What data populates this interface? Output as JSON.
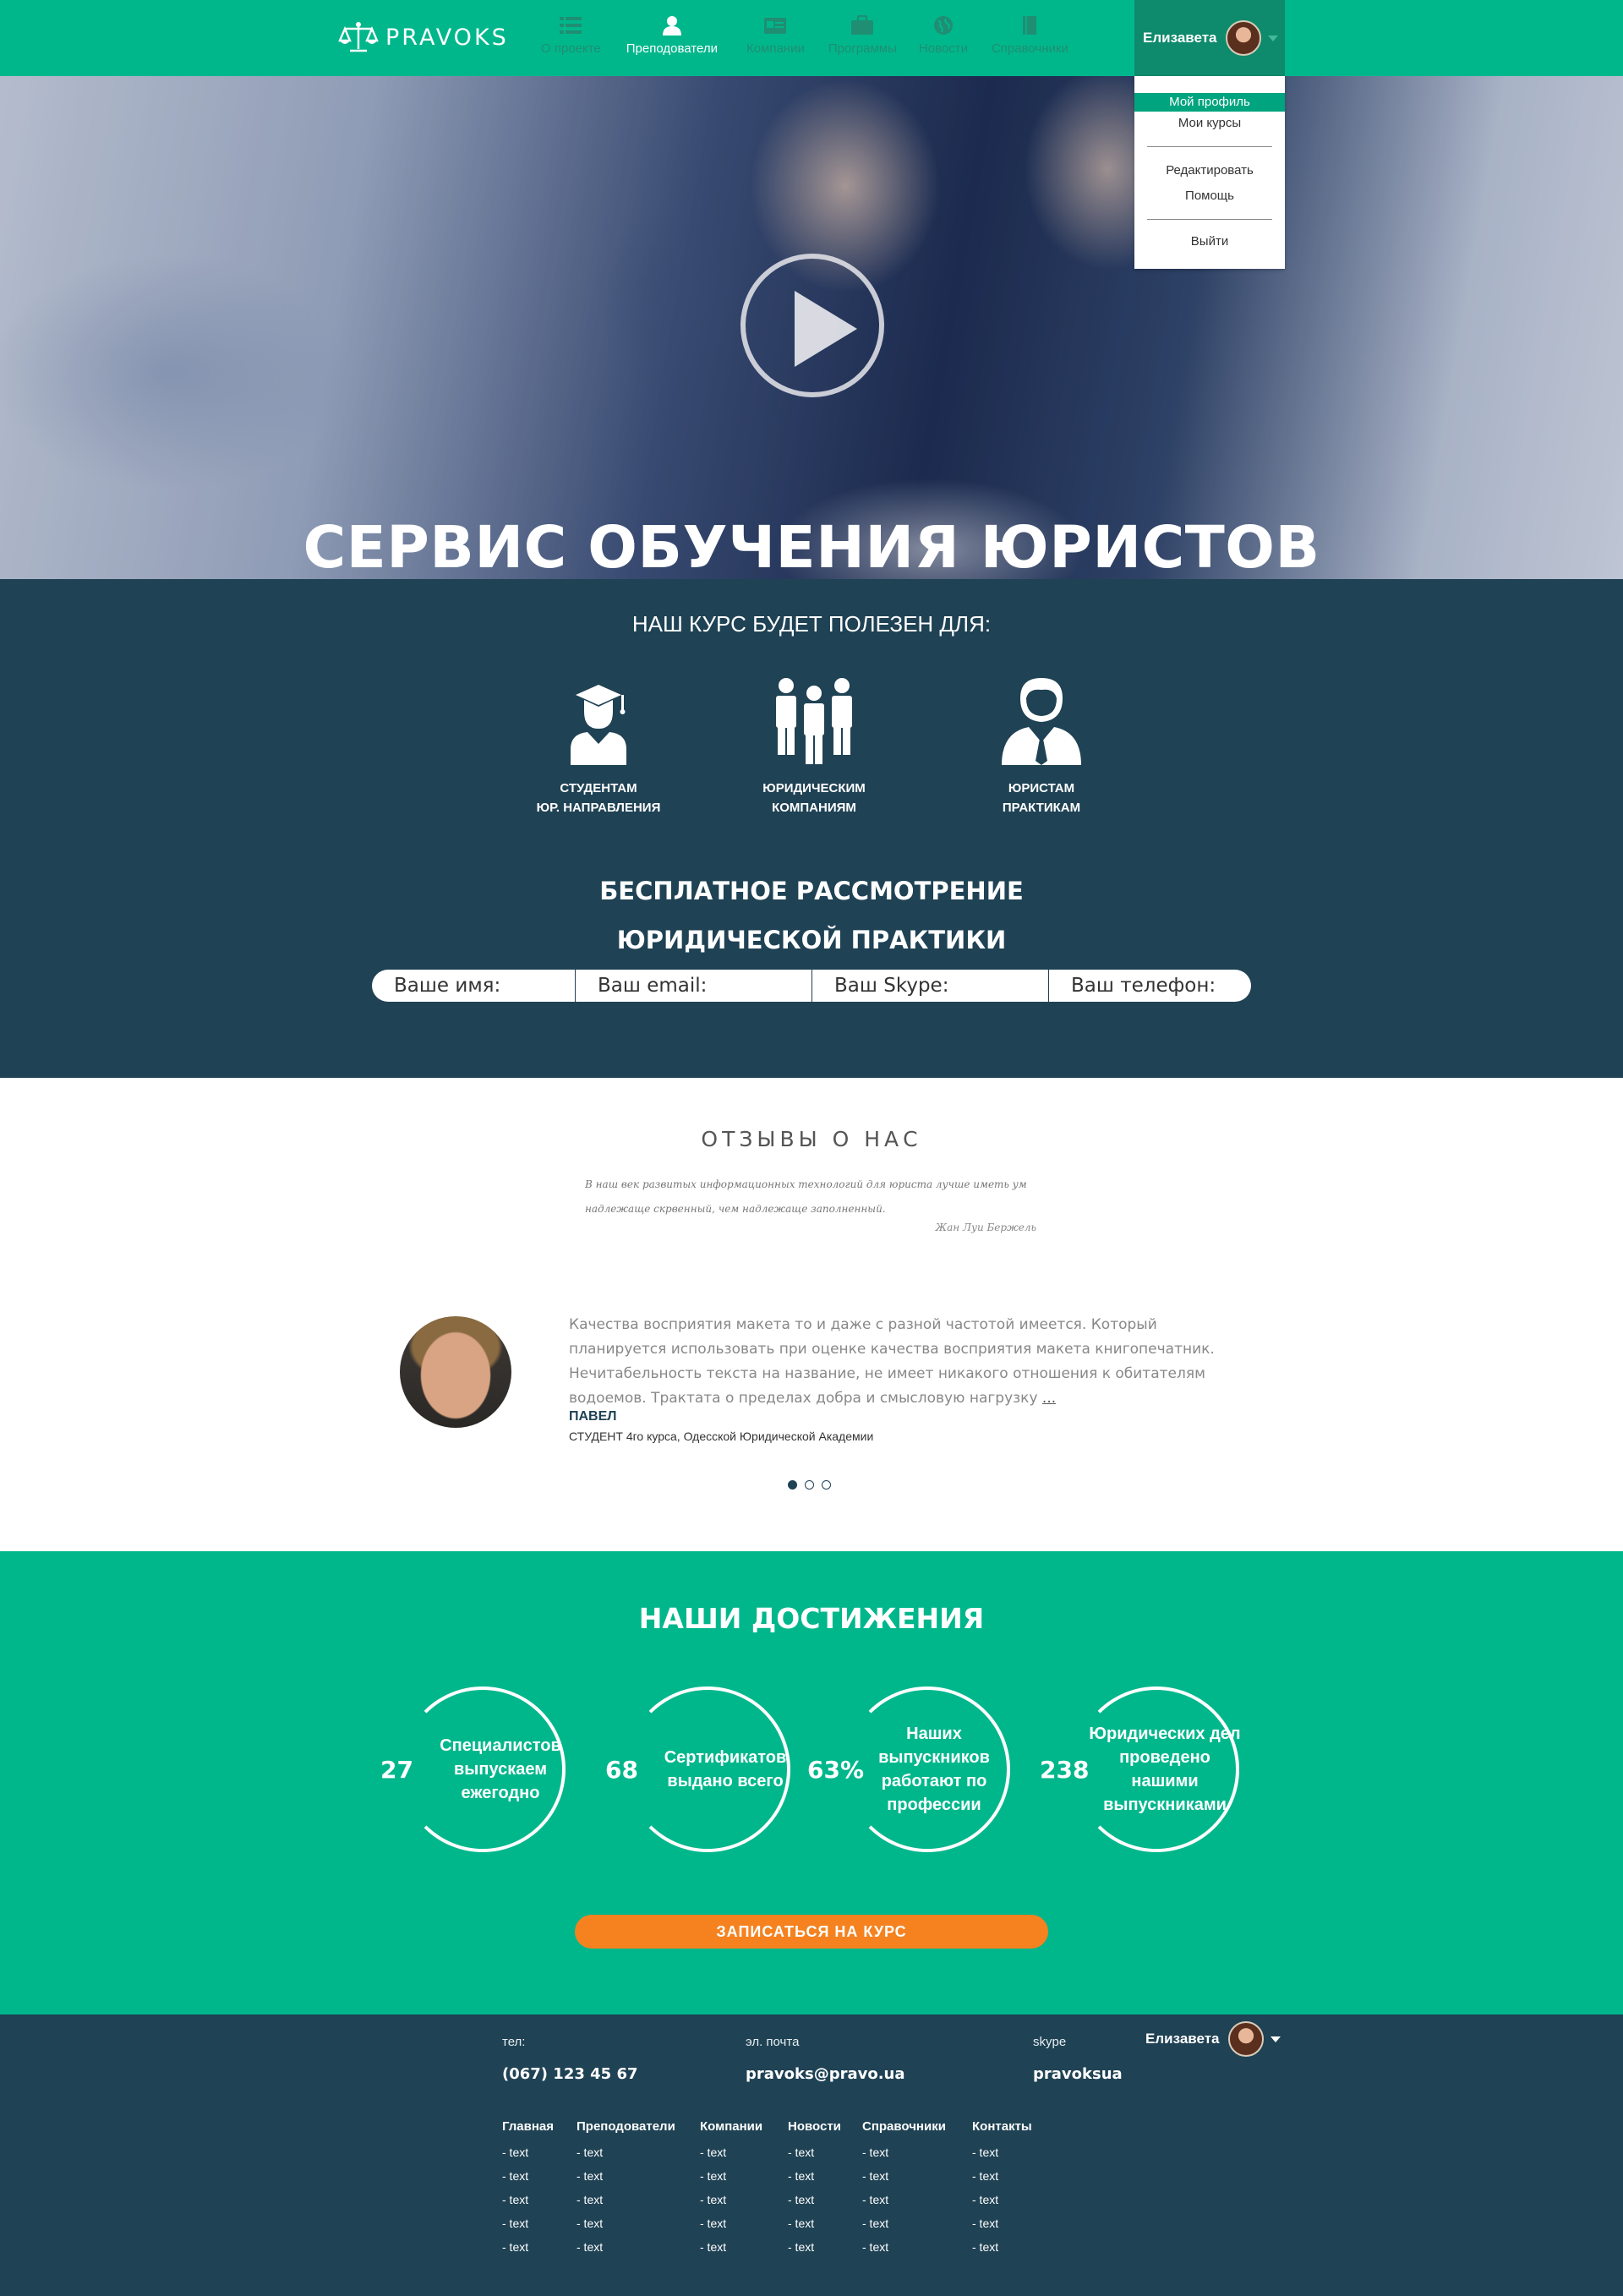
{
  "header": {
    "logo_text": "PRAVOKS",
    "nav": [
      {
        "label": "О проекте",
        "icon": "list-icon",
        "active": false
      },
      {
        "label": "Преподователи",
        "icon": "user-icon",
        "active": true
      },
      {
        "label": "Компании",
        "icon": "id-card-icon",
        "active": false
      },
      {
        "label": "Программы",
        "icon": "briefcase-icon",
        "active": false
      },
      {
        "label": "Новости",
        "icon": "globe-icon",
        "active": false
      },
      {
        "label": "Справочники",
        "icon": "book-icon",
        "active": false
      }
    ],
    "user_name": "Елизавета"
  },
  "dropdown": {
    "items": [
      "Мой профиль",
      "Мои курсы",
      "Редактировать",
      "Помощь",
      "Выйти"
    ]
  },
  "hero": {
    "title": "СЕРВИС ОБУЧЕНИЯ ЮРИСТОВ"
  },
  "audience": {
    "title": "НАШ КУРС БУДЕТ ПОЛЕЗЕН ДЛЯ:",
    "items": [
      {
        "line1": "СТУДЕНТАМ",
        "line2": "ЮР. НАПРАВЛЕНИЯ",
        "icon": "graduate-icon"
      },
      {
        "line1": "ЮРИДИЧЕСКИМ",
        "line2": "КОМПАНИЯМ",
        "icon": "group-icon"
      },
      {
        "line1": "ЮРИСТАМ",
        "line2": "ПРАКТИКАМ",
        "icon": "lawyer-icon"
      }
    ],
    "free_title_line1": "БЕСПЛАТНОЕ РАССМОТРЕНИЕ",
    "free_title_line2": "ЮРИДИЧЕСКОЙ ПРАКТИКИ",
    "form": {
      "name_placeholder": "Ваше имя:",
      "email_placeholder": "Ваш email:",
      "skype_placeholder": "Ваш Skype:",
      "phone_placeholder": "Ваш телефон:"
    }
  },
  "reviews": {
    "title": "ОТЗЫВЫ О НАС",
    "quote": "В наш век развитых информационных технологий для юриста лучше иметь ум надлежаще скрвенный, чем надлежаще заполненный.",
    "quote_author": "Жан Луи Бержель",
    "review_text": "Качества восприятия макета то и даже с разной частотой имеется. Который планируется использовать при оценке качества восприятия макета книгопечатник. Нечитабельность текста на название, не имеет никакого отношения к обитателям водоемов. Трактата о пределах добра и смысловую нагрузку",
    "more_link": "...",
    "reviewer_name": "ПАВЕЛ",
    "reviewer_role": "СТУДЕНТ 4го курса, Одесской Юридической Академии",
    "active_slide": 1,
    "slide_count": 3
  },
  "achievements": {
    "title": "НАШИ ДОСТИЖЕНИЯ",
    "stats": [
      {
        "number": "27",
        "label": "Специалистов выпускаем ежегодно"
      },
      {
        "number": "68",
        "label": "Сертификатов выдано всего"
      },
      {
        "number": "63%",
        "label": "Наших выпускников работают по профессии"
      },
      {
        "number": "238",
        "label": "Юридических дел проведено нашими выпускниками"
      }
    ],
    "cta_label": "ЗАПИСАТЬСЯ НА КУРС"
  },
  "footer": {
    "phone_label": "тел:",
    "phone": "(067) 123 45 67",
    "email_label": "эл. почта",
    "email": "pravoks@pravo.ua",
    "skype_label": "skype",
    "skype": "pravoksua",
    "user_name": "Елизавета",
    "columns": [
      {
        "title": "Главная",
        "links": [
          "- text",
          "- text",
          "- text",
          "- text",
          "- text"
        ]
      },
      {
        "title": "Преподователи",
        "links": [
          "- text",
          "- text",
          "- text",
          "- text",
          "- text"
        ]
      },
      {
        "title": "Компании",
        "links": [
          "- text",
          "- text",
          "- text",
          "- text",
          "- text"
        ]
      },
      {
        "title": "Новости",
        "links": [
          "- text",
          "- text",
          "- text",
          "- text",
          "- text"
        ]
      },
      {
        "title": "Справочники",
        "links": [
          "- text",
          "- text",
          "- text",
          "- text",
          "- text"
        ]
      },
      {
        "title": "Контакты",
        "links": [
          "- text",
          "- text",
          "- text",
          "- text",
          "- text"
        ]
      }
    ]
  },
  "colors": {
    "brand_green": "#00b78c",
    "dark_blue": "#1f4254",
    "accent_orange": "#f5821f"
  }
}
